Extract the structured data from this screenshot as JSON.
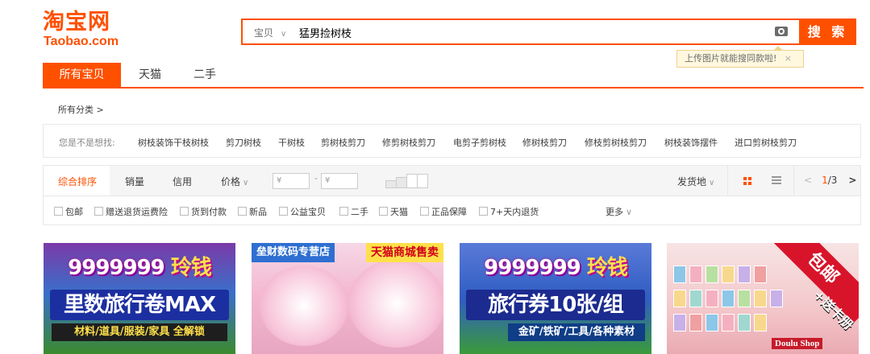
{
  "brand": {
    "logo_cn": "淘宝网",
    "logo_en": "Taobao.com",
    "accent": "#ff5000"
  },
  "search": {
    "type_label": "宝贝",
    "value": "猛男捡树枝",
    "button_label": "搜 索",
    "tooltip": "上传图片就能搜同款啦!",
    "tooltip_close": "×"
  },
  "tabs": [
    {
      "label": "所有宝贝",
      "active": true
    },
    {
      "label": "天猫",
      "active": false
    },
    {
      "label": "二手",
      "active": false
    }
  ],
  "category": {
    "all_label": "所有分类 >"
  },
  "suggest": {
    "label": "您是不是想找:",
    "items": [
      "树枝装饰干枝树枝",
      "剪刀树枝",
      "干树枝",
      "剪树枝剪刀",
      "修剪树枝剪刀",
      "电剪子剪树枝",
      "修树枝剪刀",
      "修枝剪树枝剪刀",
      "树枝装饰摆件",
      "进口剪树枝剪刀"
    ]
  },
  "sort": {
    "items": [
      "综合排序",
      "销量",
      "信用",
      "价格"
    ],
    "price_min_placeholder": "¥",
    "price_max_placeholder": "¥",
    "price_dash": "-",
    "ship_from": "发货地",
    "page_current": "1",
    "page_total": "/3",
    "prev_arrow": "<",
    "next_arrow": ">"
  },
  "filters": {
    "items": [
      "包邮",
      "赠送退货运费险",
      "货到付款",
      "新品",
      "公益宝贝",
      "二手",
      "天猫",
      "正品保障",
      "7+天内退货"
    ],
    "more": "更多"
  },
  "products": [
    {
      "headline": "9999999",
      "headline_suffix": "玲钱",
      "mid": "里数旅行卷MAX",
      "bottom": "材料/道具/服装/家具 全解锁"
    },
    {
      "shop": "垒财数码专营店",
      "tag": "天猫商城售卖"
    },
    {
      "headline": "9999999",
      "headline_suffix": "玲钱",
      "mid": "旅行券10张/组",
      "bottom": "金矿/铁矿/工具/各种素材"
    },
    {
      "ribbon": "包邮",
      "ribbon_sub": "+送卡册",
      "shop": "Doulu Shop"
    }
  ]
}
